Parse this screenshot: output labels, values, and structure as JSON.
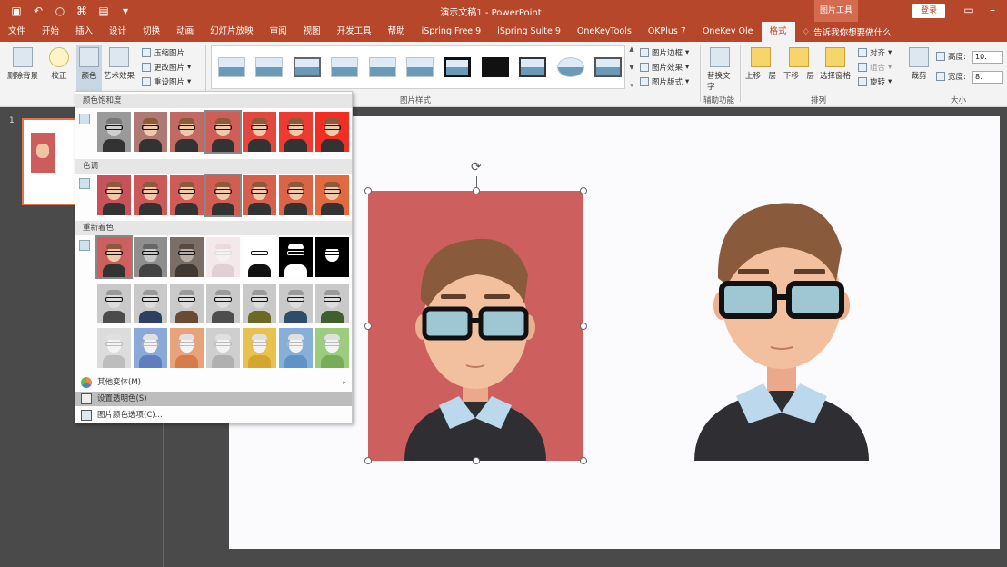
{
  "app": {
    "title": "演示文稿1 - PowerPoint",
    "tools_context": "图片工具",
    "login_label": "登录",
    "qat_icons": [
      "save-icon",
      "undo-icon",
      "redo-icon",
      "format-painter-icon",
      "customize-icon"
    ]
  },
  "tabs": [
    {
      "label": "文件"
    },
    {
      "label": "开始"
    },
    {
      "label": "插入"
    },
    {
      "label": "设计"
    },
    {
      "label": "切换"
    },
    {
      "label": "动画"
    },
    {
      "label": "幻灯片放映"
    },
    {
      "label": "审阅"
    },
    {
      "label": "视图"
    },
    {
      "label": "开发工具"
    },
    {
      "label": "帮助"
    },
    {
      "label": "iSpring Free 9"
    },
    {
      "label": "iSpring Suite 9"
    },
    {
      "label": "OneKeyTools"
    },
    {
      "label": "OKPlus 7"
    },
    {
      "label": "OneKey Ole"
    },
    {
      "label": "格式"
    }
  ],
  "active_tab": "格式",
  "tell_me": "告诉我你想要做什么",
  "ribbon": {
    "remove_bg": "删除背景",
    "corrections": "校正",
    "color": "颜色",
    "artistic": "艺术效果",
    "compress": "压缩图片",
    "change_pic": "更改图片",
    "reset_pic": "重设图片",
    "styles_group": "图片样式",
    "border": "图片边框",
    "effects": "图片效果",
    "layout": "图片版式",
    "alt_text": "替换文字",
    "accessibility_group": "辅助功能",
    "bring_forward": "上移一层",
    "send_backward": "下移一层",
    "selection_pane": "选择窗格",
    "align": "对齐",
    "group": "组合",
    "rotate": "旋转",
    "arrange_group": "排列",
    "crop": "裁剪",
    "height_label": "高度:",
    "width_label": "宽度:",
    "height_value": "10.",
    "width_value": "8.",
    "size_group": "大小"
  },
  "slide_panel": {
    "slide_number": "1"
  },
  "dropdown": {
    "sections": {
      "saturation": "颜色饱和度",
      "tone": "色调",
      "recolor": "重新着色"
    },
    "menu": {
      "more_variations": "其他变体(M)",
      "set_transparent": "设置透明色(S)",
      "picture_color_options": "图片颜色选项(C)..."
    }
  }
}
